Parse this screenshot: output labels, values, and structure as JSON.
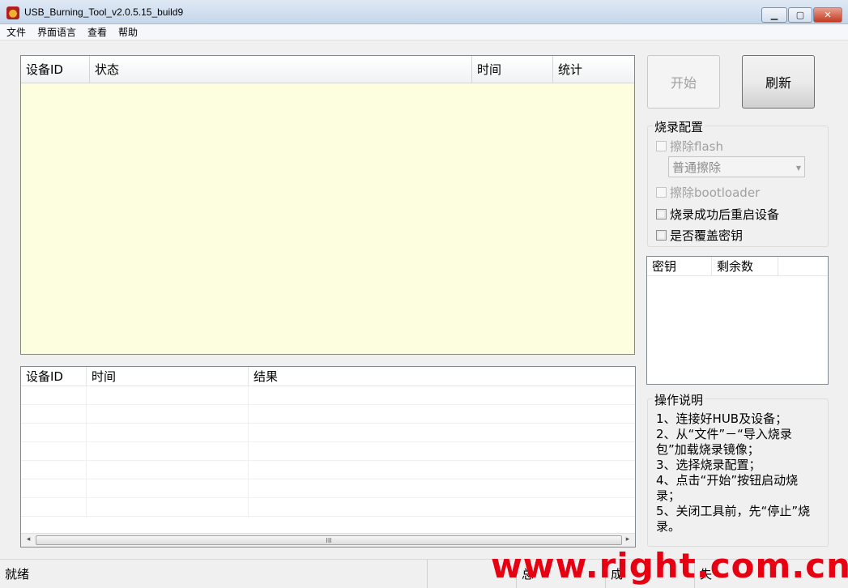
{
  "window": {
    "title": "USB_Burning_Tool_v2.0.5.15_build9",
    "controls": {
      "minimize": "▁",
      "maximize": "▢",
      "close": "✕"
    }
  },
  "menu": [
    "文件",
    "界面语言",
    "查看",
    "帮助"
  ],
  "device_table": {
    "columns": [
      "设备ID",
      "状态",
      "时间",
      "统计"
    ],
    "rows": []
  },
  "result_table": {
    "columns": [
      "设备ID",
      "时间",
      "结果"
    ],
    "rows": [],
    "scrollbar": {
      "left": "◂",
      "right": "▸",
      "grip": "III"
    }
  },
  "buttons": {
    "start": "开始",
    "refresh": "刷新"
  },
  "burn_config": {
    "title": "烧录配置",
    "erase_flash": {
      "label": "擦除flash",
      "checked": false,
      "enabled": false
    },
    "erase_mode": {
      "value": "普通擦除",
      "enabled": false
    },
    "erase_bootloader": {
      "label": "擦除bootloader",
      "checked": false,
      "enabled": false
    },
    "reboot_after": {
      "label": "烧录成功后重启设备",
      "checked": false,
      "enabled": true
    },
    "overwrite_key": {
      "label": "是否覆盖密钥",
      "checked": false,
      "enabled": true
    }
  },
  "key_table": {
    "columns": [
      "密钥",
      "剩余数"
    ],
    "rows": []
  },
  "instructions": {
    "title": "操作说明",
    "lines": [
      "1、连接好HUB及设备；",
      "2、从“文件”－“导入烧录包”加载烧录镜像；",
      "3、选择烧录配置；",
      "4、点击“开始”按钮启动烧录；",
      "5、关闭工具前，先“停止”烧录。"
    ]
  },
  "statusbar": {
    "status": "就绪",
    "total": "总",
    "success": "成",
    "fail": "失"
  },
  "watermark": "www.right.com.cn",
  "colors": {
    "device_table_bg": "#fdfde0",
    "watermark": "#e60012"
  }
}
